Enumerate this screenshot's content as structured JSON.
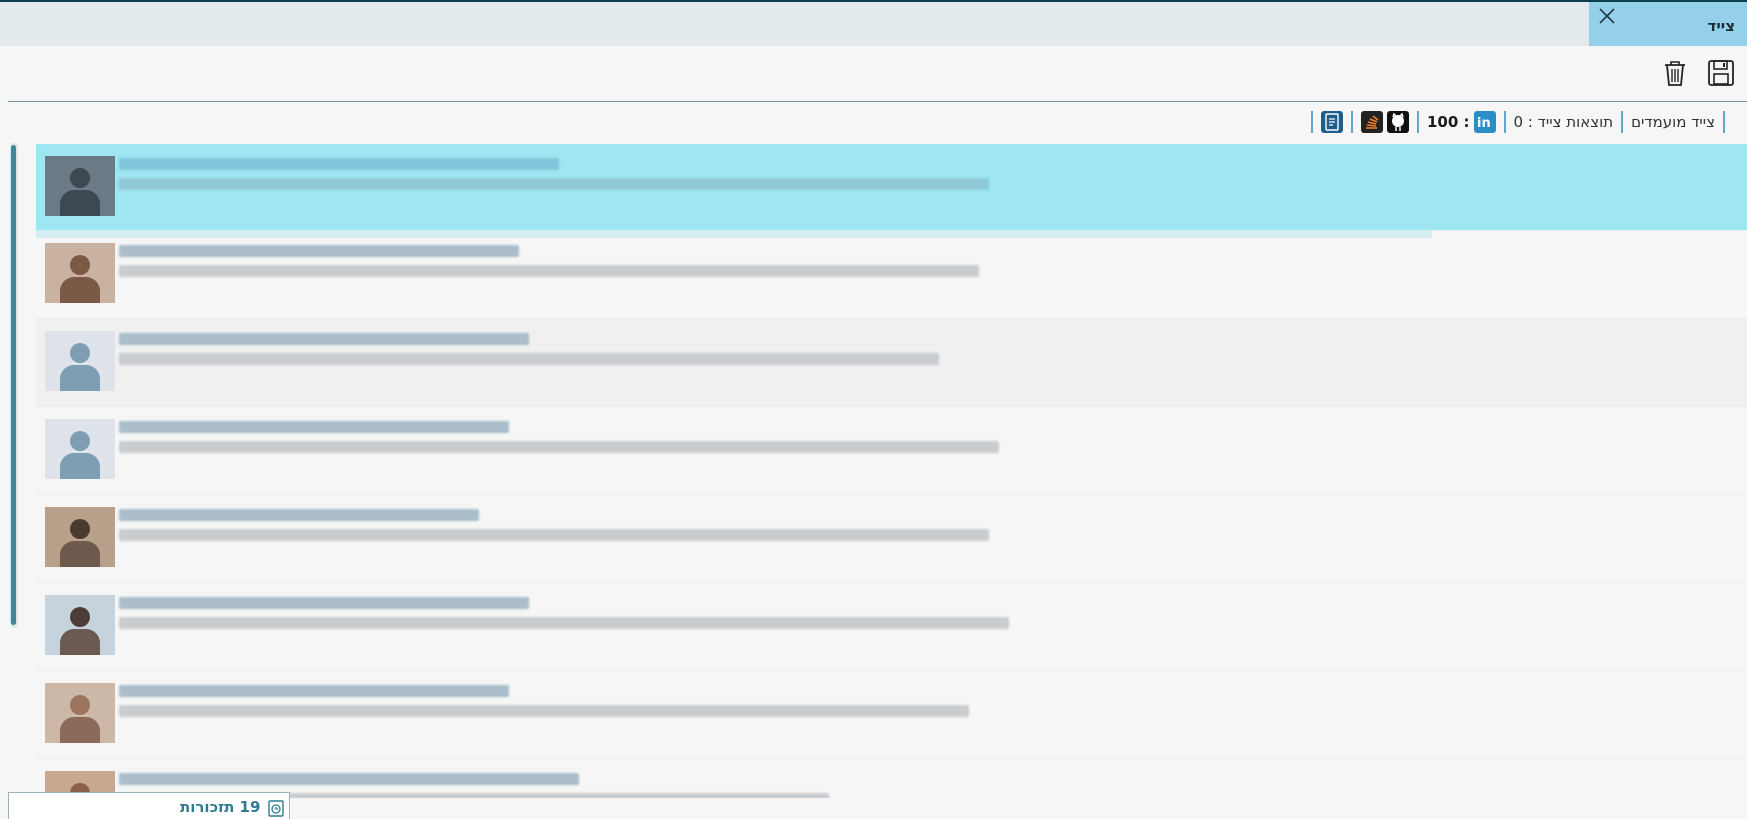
{
  "window": {
    "title": "צייד"
  },
  "toolbar": {
    "save_icon": "floppy-disk-icon",
    "delete_icon": "trash-icon"
  },
  "filters": {
    "candidates_label": "צייד מועמדים",
    "results_label": "תוצאות צייד : 0",
    "linkedin_score": "100 :",
    "icons": [
      "linkedin-icon",
      "github-icon",
      "stackoverflow-icon",
      "document-icon"
    ]
  },
  "candidates": [
    {
      "selected": true
    },
    {
      "selected": false
    },
    {
      "selected": false
    },
    {
      "selected": false
    },
    {
      "selected": false
    },
    {
      "selected": false
    },
    {
      "selected": false
    },
    {
      "selected": false
    }
  ],
  "footer": {
    "reminders_label": "19 תזכורות"
  },
  "colors": {
    "selected_row": "#9ee6f2",
    "header_tab": "#95d0ea",
    "accent": "#2d7a92"
  }
}
